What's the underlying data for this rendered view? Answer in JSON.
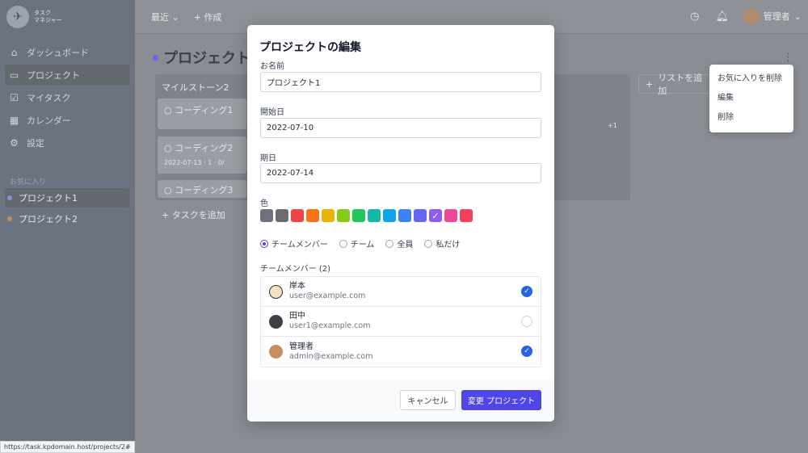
{
  "sidebar": {
    "logo_line1": "タスク",
    "logo_line2": "マネジャー",
    "items": [
      {
        "label": "ダッシュボード",
        "icon": "home-icon"
      },
      {
        "label": "プロジェクト",
        "icon": "folder-icon"
      },
      {
        "label": "マイタスク",
        "icon": "checkbox-icon"
      },
      {
        "label": "カレンダー",
        "icon": "calendar-icon"
      },
      {
        "label": "設定",
        "icon": "gear-icon"
      }
    ],
    "favorites_title": "お気に入り",
    "favorites": [
      {
        "label": "プロジェクト1",
        "color": "#8b8fd9"
      },
      {
        "label": "プロジェクト2",
        "color": "#c48a5a"
      }
    ]
  },
  "status_url": "https://task.kpdomain.host/projects/2#",
  "topbar": {
    "recent": "最近",
    "create": "作成",
    "user": "管理者"
  },
  "board": {
    "project_title": "プロジェクト1",
    "column_title": "マイルストーン2",
    "tasks": [
      "コーディング1",
      "コーディング2",
      "コーディング3"
    ],
    "task2_date": "2022-07-13",
    "task2_comments": "1",
    "task2_progress": "0/",
    "add_task": "タスクを追加",
    "add_list": "リストを追加",
    "extra_count": "+1"
  },
  "context_menu": {
    "items": [
      "お気に入りを削除",
      "編集",
      "削除"
    ]
  },
  "modal": {
    "title": "プロジェクトの編集",
    "name_label": "お名前",
    "name_value": "プロジェクト1",
    "start_label": "開始日",
    "start_value": "2022-07-10",
    "due_label": "期日",
    "due_value": "2022-07-14",
    "color_label": "色",
    "colors": [
      "#6b7280",
      "#6b6b70",
      "#ef4444",
      "#f97316",
      "#eab308",
      "#84cc16",
      "#22c55e",
      "#14b8a6",
      "#0ea5e9",
      "#3b82f6",
      "#6366f1",
      "#8b5cf6",
      "#ec4899",
      "#f43f5e"
    ],
    "selected_color_index": 11,
    "visibility": [
      {
        "label": "チームメンバー",
        "checked": true
      },
      {
        "label": "チーム",
        "checked": false
      },
      {
        "label": "全員",
        "checked": false
      },
      {
        "label": "私だけ",
        "checked": false
      }
    ],
    "members_label": "チームメンバー (2)",
    "members": [
      {
        "name": "岸本",
        "email": "user@example.com",
        "checked": true,
        "avatar_color": "#f3e3c3"
      },
      {
        "name": "田中",
        "email": "user1@example.com",
        "checked": false,
        "avatar_color": "#3f3f46"
      },
      {
        "name": "管理者",
        "email": "admin@example.com",
        "checked": true,
        "avatar_color": "#c98e5d"
      }
    ],
    "cancel_label": "キャンセル",
    "save_label": "変更 プロジェクト"
  }
}
